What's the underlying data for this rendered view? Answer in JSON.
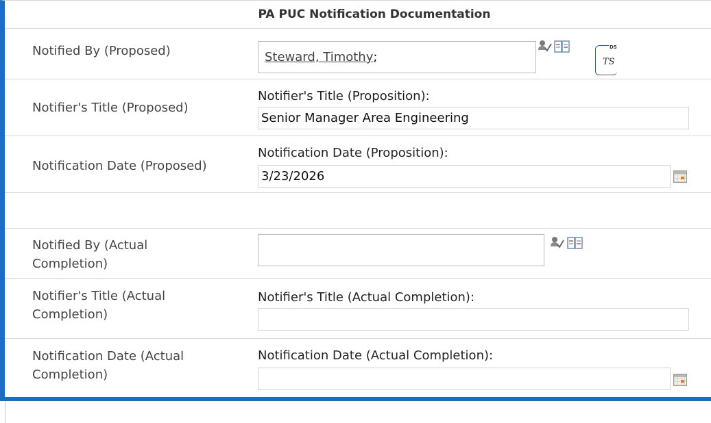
{
  "header": {
    "title": "PA PUC Notification Documentation"
  },
  "proposed": {
    "notified_by": {
      "label": "Notified By (Proposed)",
      "value": "Steward, Timothy",
      "separator": ";",
      "signature_badge": {
        "tag": "DS",
        "initials": "TS"
      }
    },
    "title": {
      "label": "Notifier's Title (Proposed)",
      "field_label": "Notifier's Title (Proposition):",
      "value": "Senior Manager Area Engineering"
    },
    "date": {
      "label": "Notification Date (Proposed)",
      "field_label": "Notification Date (Proposition):",
      "value": "3/23/2026"
    }
  },
  "actual": {
    "notified_by": {
      "label_line1": "Notified By (Actual",
      "label_line2": "Completion)",
      "value": ""
    },
    "title": {
      "label_line1": "Notifier's Title (Actual",
      "label_line2": "Completion)",
      "field_label": "Notifier's Title (Actual Completion):",
      "value": ""
    },
    "date": {
      "label_line1": "Notification Date (Actual",
      "label_line2": "Completion)",
      "field_label": "Notification Date (Actual Completion):",
      "value": ""
    }
  },
  "icons": {
    "check_names": "check-names-icon",
    "address_book": "address-book-icon",
    "calendar": "calendar-icon"
  },
  "colors": {
    "accent": "#1b6ec2",
    "row_border": "#d6d6d6"
  }
}
